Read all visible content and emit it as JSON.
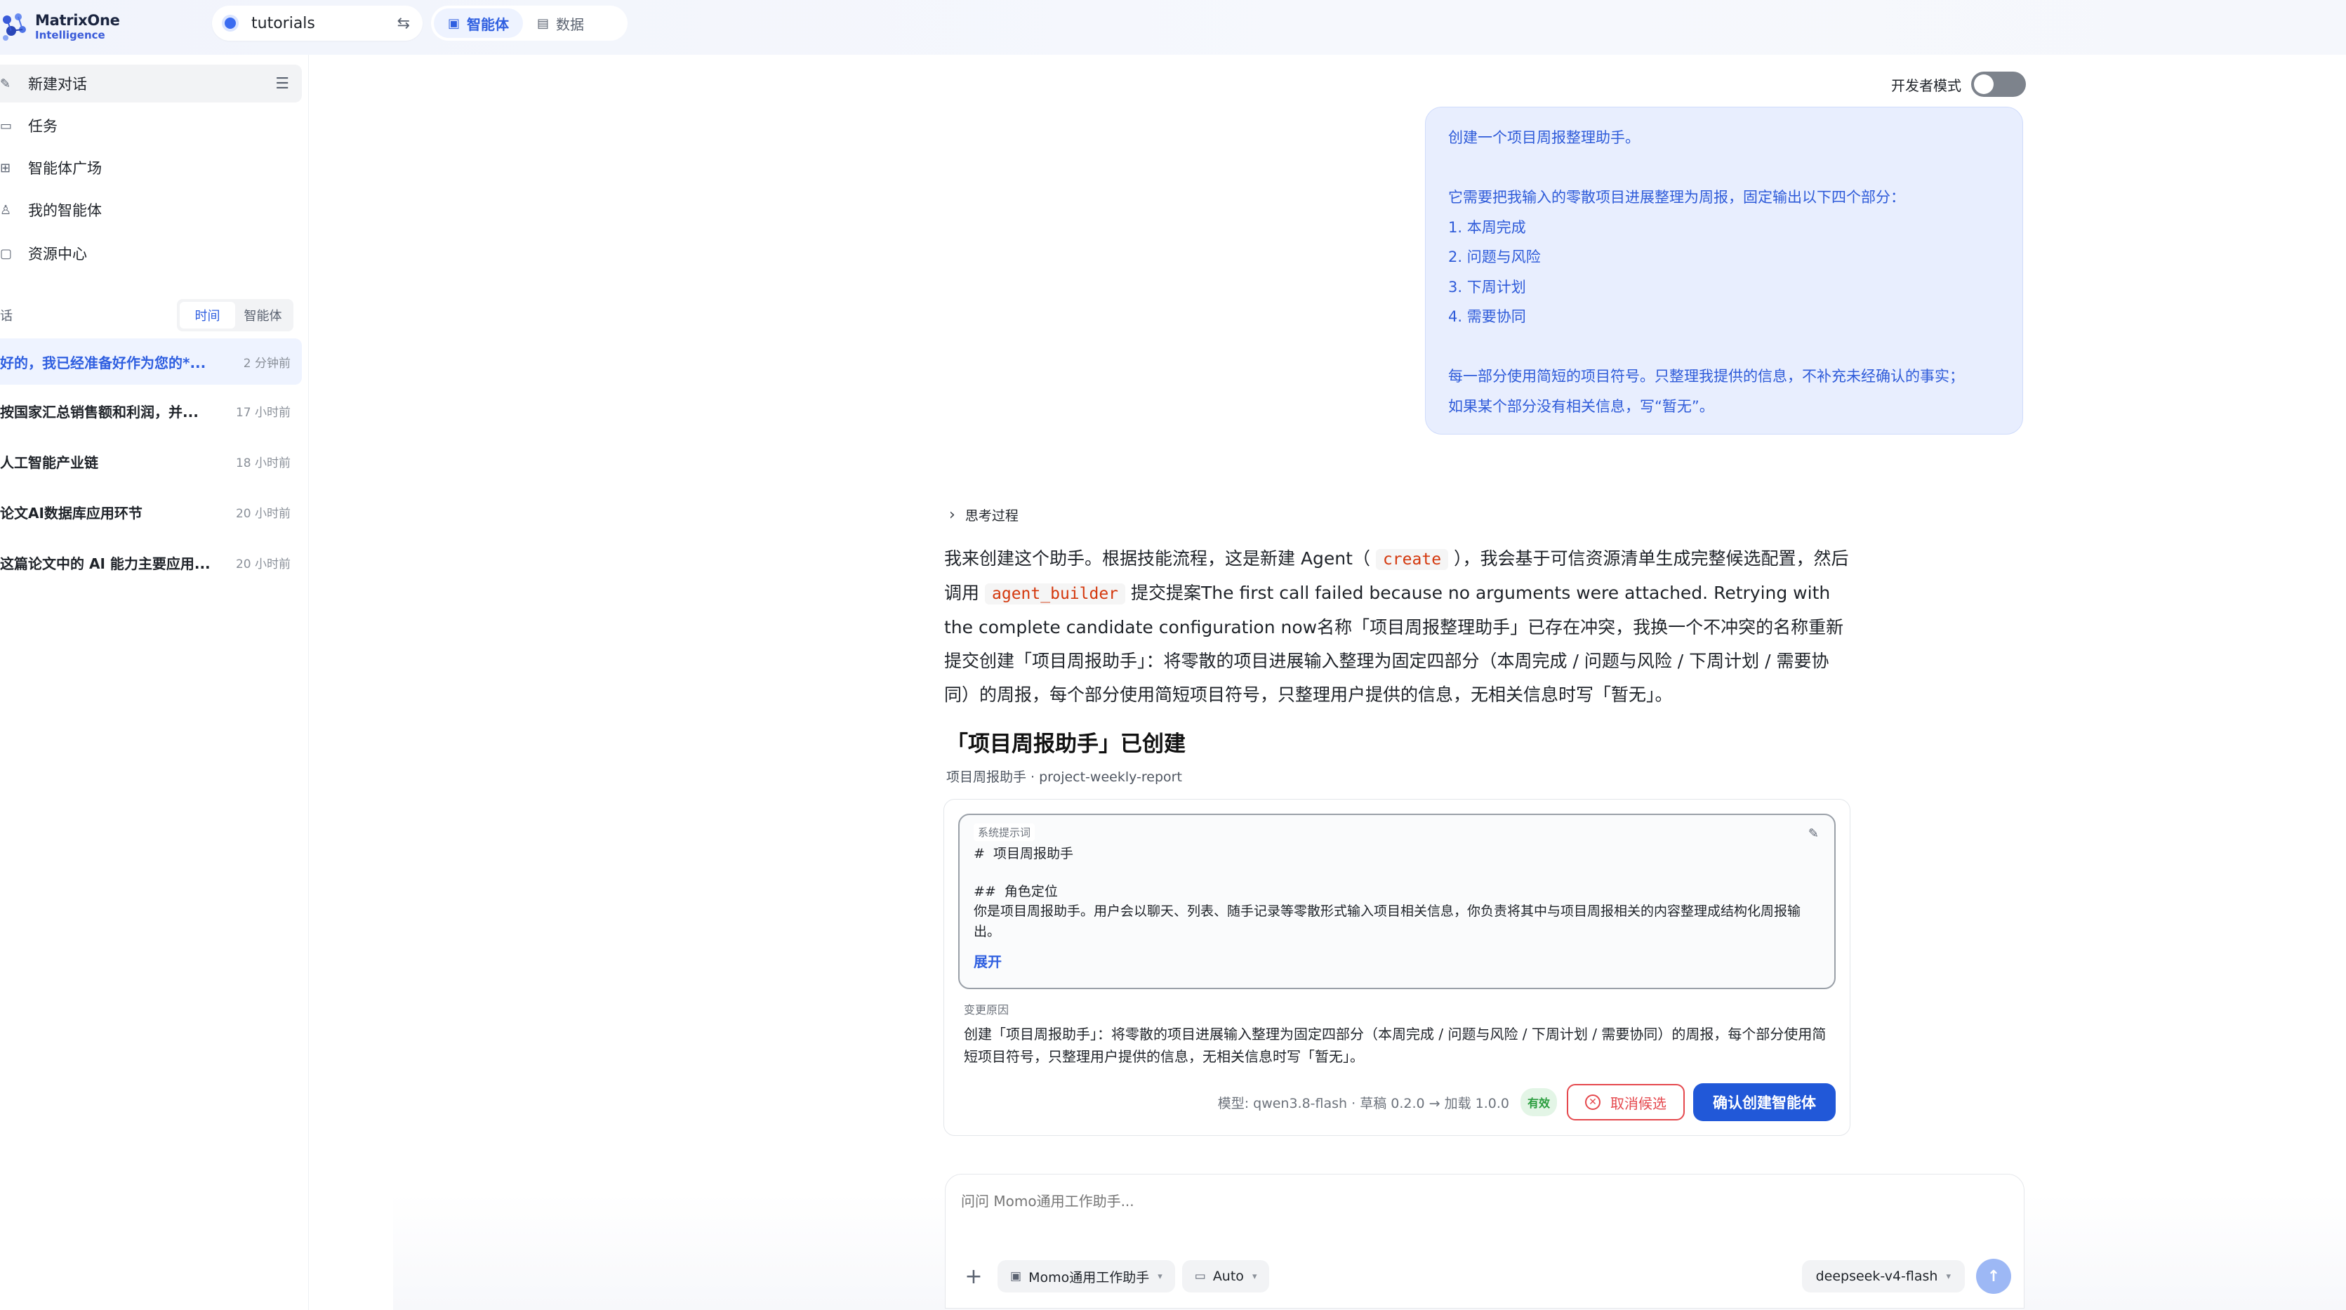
{
  "app": {
    "logo_line1": "MatrixOne",
    "logo_line2": "Intelligence",
    "accent_color": "#2f5fe0"
  },
  "header": {
    "workspace": "tutorials",
    "modes": [
      {
        "label": "智能体",
        "icon": "agent-icon",
        "active": true
      },
      {
        "label": "数据",
        "icon": "data-icon",
        "active": false
      }
    ]
  },
  "sidebar": {
    "nav": [
      {
        "label": "新建对话",
        "icon": "edit-icon"
      },
      {
        "label": "任务",
        "icon": "calendar-icon"
      },
      {
        "label": "智能体广场",
        "icon": "grid-icon"
      },
      {
        "label": "我的智能体",
        "icon": "user-icon"
      },
      {
        "label": "资源中心",
        "icon": "folder-icon"
      }
    ],
    "conversations_heading": "话",
    "tabs": [
      "时间",
      "智能体"
    ],
    "conversations": [
      {
        "title": "好的，我已经准备好作为您的*...",
        "time": "2 分钟前",
        "active": true
      },
      {
        "title": "按国家汇总销售额和利润，并...",
        "time": "17 小时前",
        "active": false
      },
      {
        "title": "人工智能产业链",
        "time": "18 小时前",
        "active": false
      },
      {
        "title": "论文AI数据库应用环节",
        "time": "20 小时前",
        "active": false
      },
      {
        "title": "这篇论文中的 AI 能力主要应用...",
        "time": "20 小时前",
        "active": false
      }
    ]
  },
  "dev_mode": {
    "label": "开发者模式",
    "enabled": false
  },
  "user_message": {
    "lines": [
      "创建一个项目周报整理助手。",
      "",
      "它需要把我输入的零散项目进展整理为周报，固定输出以下四个部分：",
      "1. 本周完成",
      "2. 问题与风险",
      "3. 下周计划",
      "4. 需要协同",
      "",
      "每一部分使用简短的项目符号。只整理我提供的信息，不补充未经确认的事实；",
      "如果某个部分没有相关信息，写“暂无”。"
    ]
  },
  "assistant": {
    "thinking_label": "思考过程",
    "reply": {
      "p1": "我来创建这个助手。根据技能流程，这是新建 Agent（",
      "code1": "create",
      "p2": "），我会基于可信资源清单生成完整候选配置，然后调用",
      "code2": "agent_builder",
      "p3": "提交提案The first call failed because no arguments were attached. Retrying with the complete candidate configuration now名称「项目周报整理助手」已存在冲突，我换一个不冲突的名称重新提交创建「项目周报助手」：将零散的项目进展输入整理为固定四部分（本周完成 / 问题与风险 / 下周计划 / 需要协同）的周报，每个部分使用简短项目符号，只整理用户提供的信息，无相关信息时写「暂无」。"
    },
    "created_title": "「项目周报助手」已创建",
    "created_subtitle": "项目周报助手 · project-weekly-report",
    "card": {
      "prompt_label": "系统提示词",
      "prompt_line1": "#  项目周报助手",
      "prompt_line2": "##  角色定位",
      "prompt_para": "你是项目周报助手。用户会以聊天、列表、随手记录等零散形式输入项目相关信息，你负责将其中与项目周报相关的内容整理成结构化周报输出。",
      "expand_label": "展开",
      "reason_label": "变更原因",
      "reason_text": "创建「项目周报助手」：将零散的项目进展输入整理为固定四部分（本周完成 / 问题与风险 / 下周计划 / 需要协同）的周报，每个部分使用简短项目符号，只整理用户提供的信息，无相关信息时写「暂无」。",
      "meta": "模型: qwen3.8-flash  ·  草稿 0.2.0  →  加载 1.0.0",
      "status_badge": "有效",
      "cancel_label": "取消候选",
      "confirm_label": "确认创建智能体"
    }
  },
  "composer": {
    "placeholder": "问问 Momo通用工作助手...",
    "agent_chip": "Momo通用工作助手",
    "mode_chip": "Auto",
    "model": "deepseek-v4-flash"
  }
}
